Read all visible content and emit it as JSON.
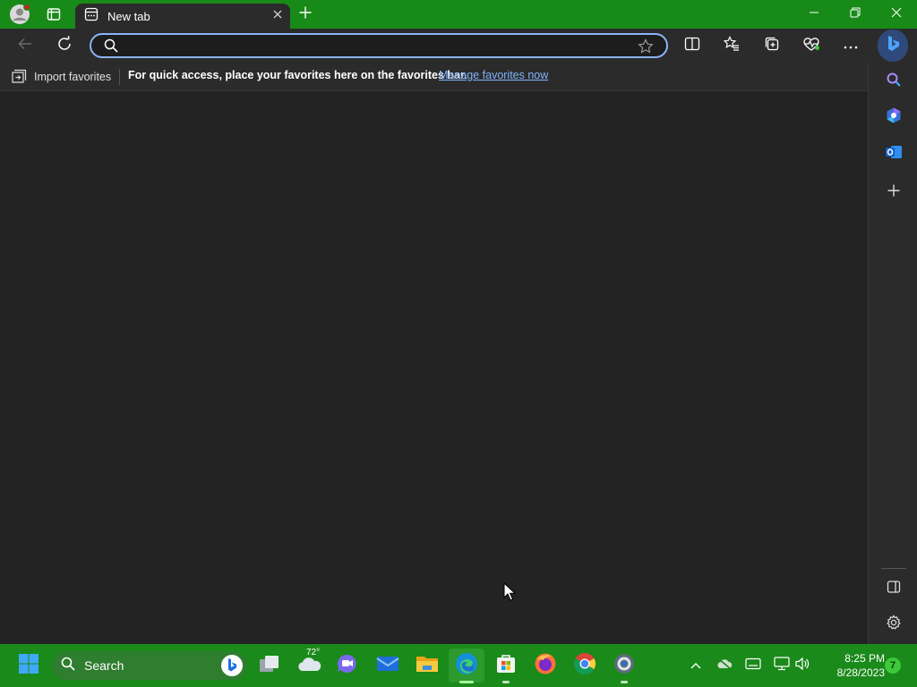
{
  "tab": {
    "title": "New tab"
  },
  "address_bar": {
    "value": "",
    "placeholder": ""
  },
  "favorites_bar": {
    "import_label": "Import favorites",
    "message": "For quick access, place your favorites here on the favorites bar.",
    "manage_link": "Manage favorites now"
  },
  "taskbar": {
    "search_label": "Search",
    "weather_temp": "72°",
    "time": "8:25 PM",
    "date": "8/28/2023",
    "notification_count": "7"
  },
  "colors": {
    "titlebar": "#188a18",
    "taskbar": "#1a8a1a",
    "toolbar": "#2b2b2b",
    "content": "#232323",
    "address_focus": "#8ab4f8",
    "link": "#7fb4ff"
  },
  "icons": {
    "titlebar": [
      "profile-avatar-icon",
      "tab-actions-icon",
      "new-tab-page-icon",
      "close-tab-icon",
      "plus-icon",
      "minimize-icon",
      "restore-icon",
      "close-window-icon"
    ],
    "toolbar": [
      "back-arrow-icon",
      "refresh-icon",
      "search-icon",
      "star-icon",
      "split-screen-icon",
      "favorites-icon",
      "collections-icon",
      "browser-essentials-icon",
      "more-icon",
      "bing-copilot-icon"
    ],
    "sidebar": [
      "search-icon",
      "copilot-icon",
      "outlook-icon",
      "plus-icon",
      "sidebar-toggle-icon",
      "settings-gear-icon"
    ],
    "taskbar": [
      "windows-start-icon",
      "search-icon",
      "bing-icon",
      "task-view-icon",
      "weather-icon",
      "teams-chat-icon",
      "mail-icon",
      "file-explorer-icon",
      "edge-icon",
      "store-icon",
      "firefox-icon",
      "chrome-icon",
      "settings-icon",
      "chevron-up-icon",
      "onedrive-icon",
      "touch-keyboard-icon",
      "network-icon",
      "volume-icon"
    ]
  }
}
